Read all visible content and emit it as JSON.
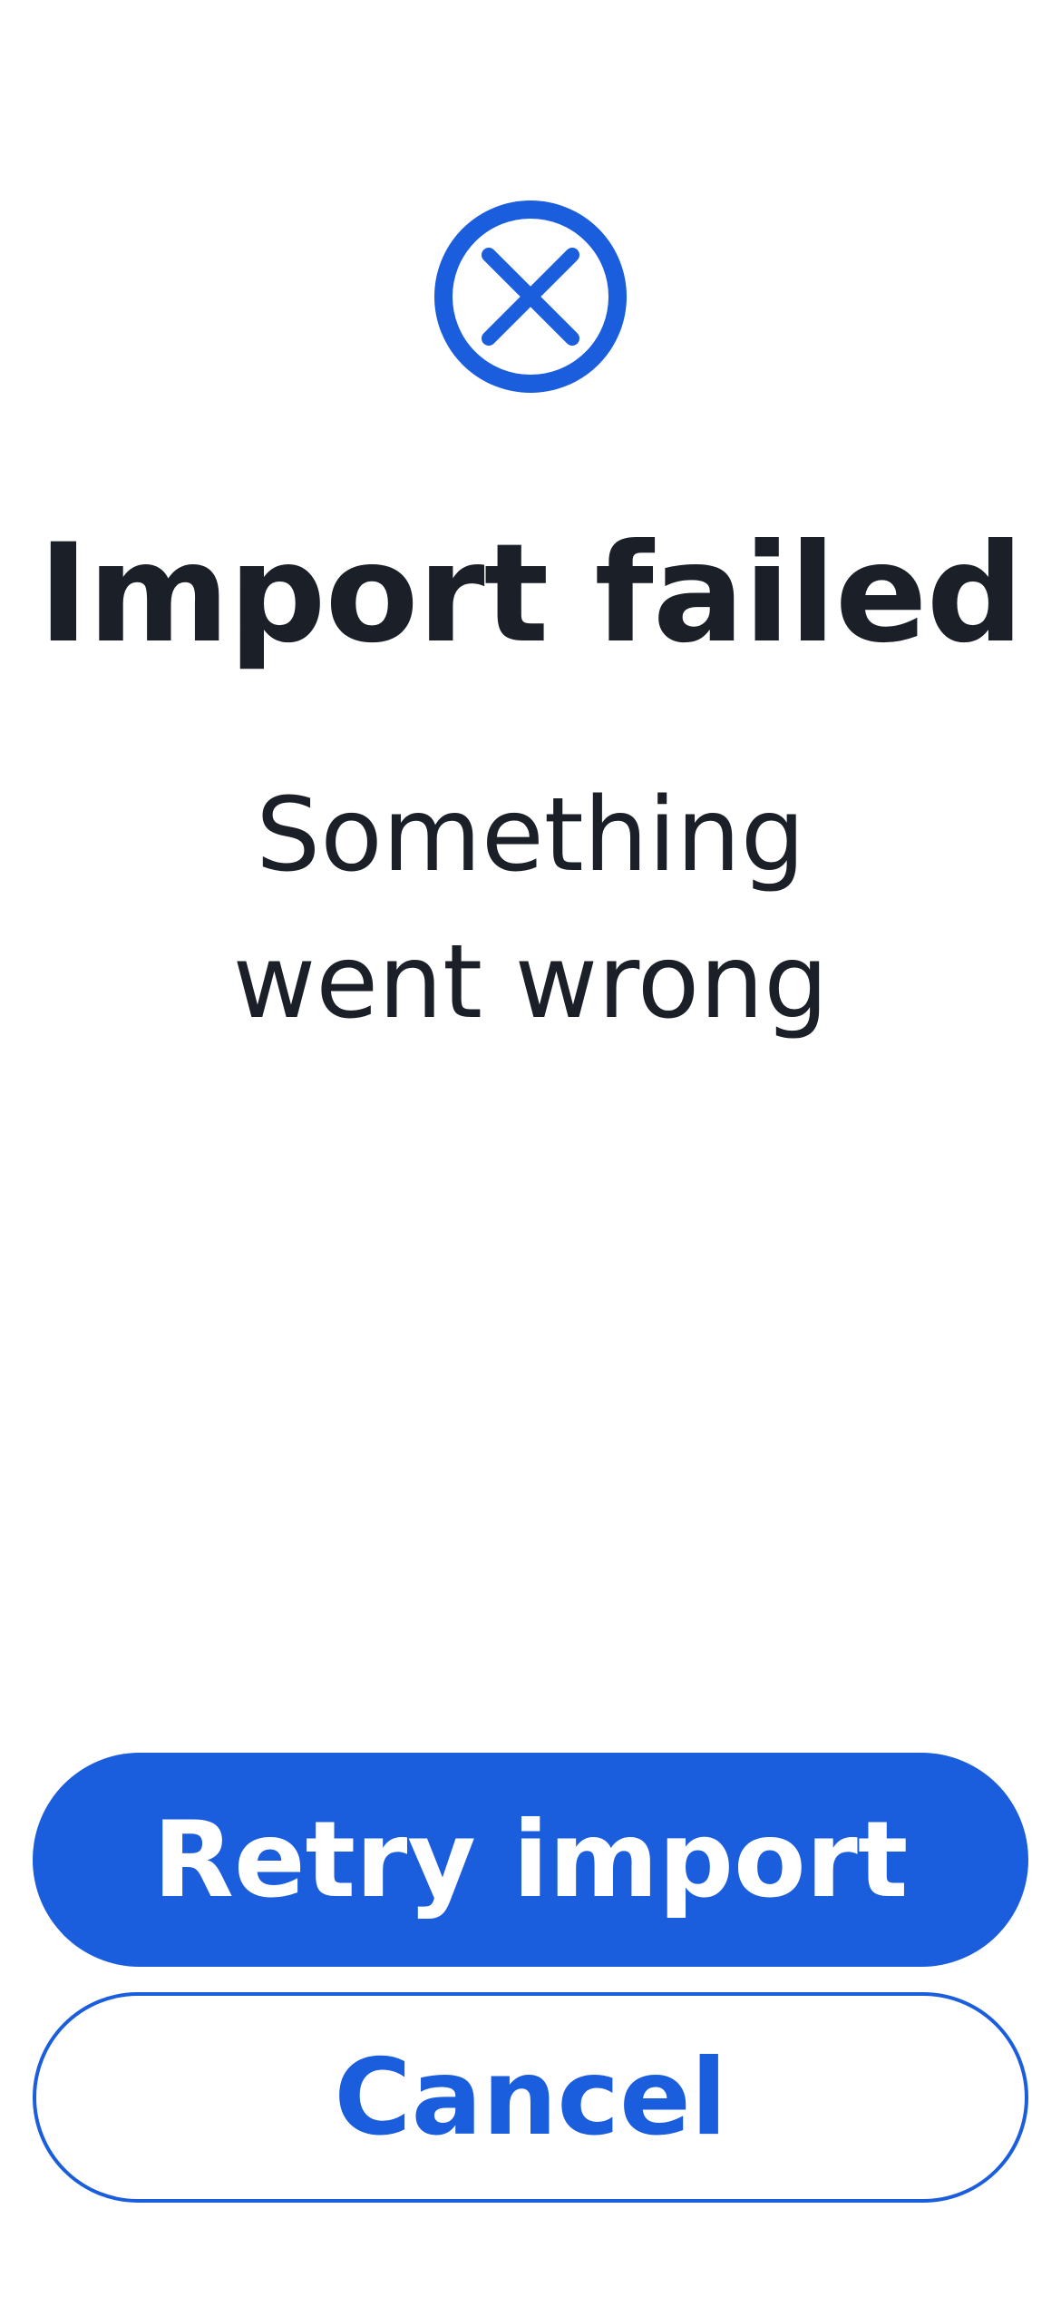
{
  "dialog": {
    "icon": "close-circle-icon",
    "title": "Import failed",
    "message_line1": "Something",
    "message_line2": "went wrong"
  },
  "actions": {
    "primary_label": "Retry import",
    "secondary_label": "Cancel"
  },
  "colors": {
    "accent": "#1a5ddd",
    "text": "#1b1f27",
    "background": "#ffffff"
  }
}
